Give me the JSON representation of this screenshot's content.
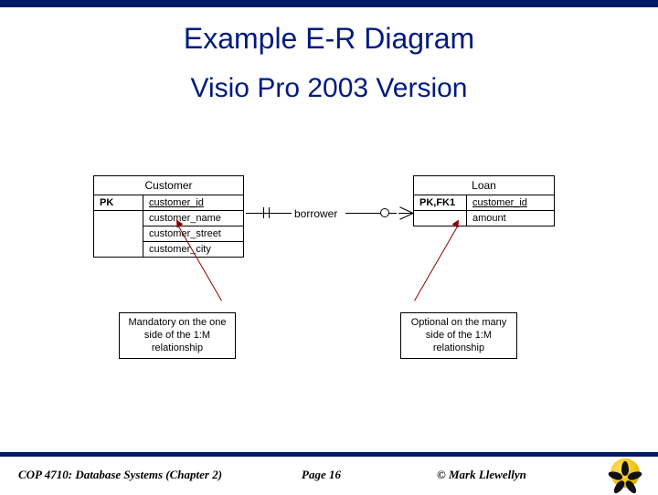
{
  "titles": {
    "main": "Example E-R Diagram",
    "sub": "Visio Pro 2003 Version"
  },
  "entities": {
    "customer": {
      "name": "Customer",
      "key_label": "PK",
      "pk_attr": "customer_id",
      "attrs": [
        "customer_name",
        "customer_street",
        "customer_city"
      ]
    },
    "loan": {
      "name": "Loan",
      "key_label": "PK,FK1",
      "pk_attr": "customer_id",
      "attrs": [
        "amount"
      ]
    }
  },
  "relationship": {
    "label": "borrower",
    "left_notation": "mandatory-one",
    "right_notation": "optional-many"
  },
  "callouts": {
    "left": "Mandatory on the one side of the 1:M relationship",
    "right": "Optional on the many side of the 1:M relationship"
  },
  "footer": {
    "left": "COP 4710: Database Systems  (Chapter 2)",
    "center": "Page 16",
    "right": "© Mark Llewellyn"
  },
  "logo_name": "ucf-pegasus-logo"
}
